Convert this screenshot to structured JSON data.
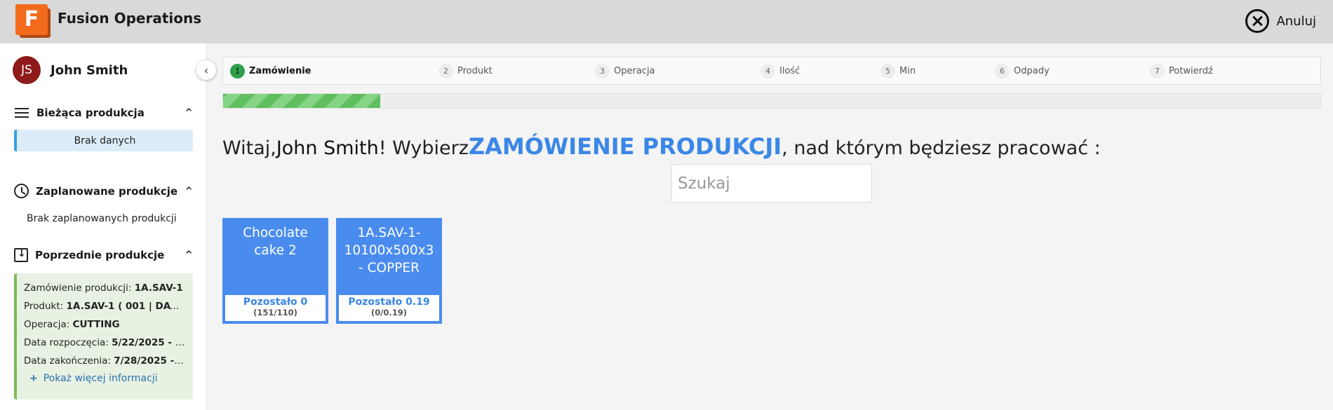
{
  "header": {
    "logo_letter": "F",
    "app_title": "Fusion Operations",
    "cancel_label": "Anuluj"
  },
  "sidebar": {
    "collapse_icon": "‹",
    "user": {
      "initials": "JS",
      "name": "John Smith"
    },
    "current": {
      "title": "Bieżąca produkcja",
      "empty": "Brak danych",
      "chevron": "^"
    },
    "planned": {
      "title": "Zaplanowane produkcje",
      "empty": "Brak zaplanowanych produkcji",
      "chevron": "^"
    },
    "previous": {
      "title": "Poprzednie produkcje",
      "chevron": "^",
      "fields": [
        {
          "label": "Zamówienie produkcji: ",
          "value": "1A.SAV-1"
        },
        {
          "label": "Produkt: ",
          "value": "1A.SAV-1 ( 001 | DAY ..."
        },
        {
          "label": "Operacja: ",
          "value": "CUTTING"
        },
        {
          "label": "Data rozpoczęcia: ",
          "value": "5/22/2025 - ..."
        },
        {
          "label": "Data zakończenia: ",
          "value": "7/28/2025 - ..."
        }
      ],
      "more_plus": "+",
      "more_label": "Pokaż więcej informacji"
    }
  },
  "stepper": {
    "steps": [
      {
        "num": "1",
        "label": "Zamówienie",
        "active": true
      },
      {
        "num": "2",
        "label": "Produkt"
      },
      {
        "num": "3",
        "label": "Operacja"
      },
      {
        "num": "4",
        "label": "Ilość"
      },
      {
        "num": "5",
        "label": "Min"
      },
      {
        "num": "6",
        "label": "Odpady"
      },
      {
        "num": "7",
        "label": "Potwierdź"
      }
    ]
  },
  "progress": {
    "percent": 14.3
  },
  "main": {
    "welcome_prefix": "Witaj,",
    "welcome_name": "John Smith",
    "welcome_mid": "! Wybierz",
    "welcome_highlight": "ZAMÓWIENIE PRODUKCJI",
    "welcome_suffix": ", nad którym będziesz pracować :",
    "search_placeholder": "Szukaj"
  },
  "orders": [
    {
      "title": "Chocolate cake 2",
      "remaining": "Pozostało 0",
      "count": "(151/110)"
    },
    {
      "title": "1A.SAV-1-10100x500x3 - COPPER",
      "remaining": "Pozostało 0.19",
      "count": "(0/0.19)"
    }
  ],
  "colors": {
    "accent": "#3b87e6",
    "card": "#4a8cee",
    "progress": "#5fbf5f",
    "active_step": "#2e9e4a",
    "avatar": "#8e1a1a",
    "logo": "#f26b1d"
  }
}
